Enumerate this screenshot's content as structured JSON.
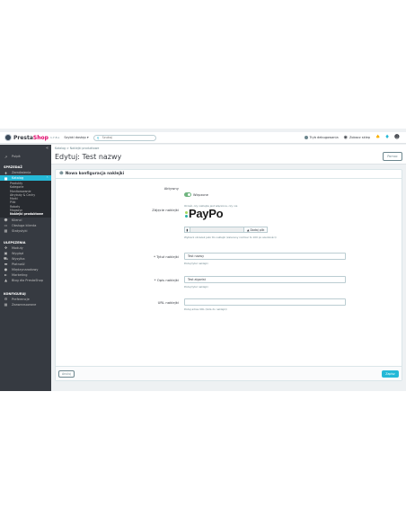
{
  "topbar": {
    "logo_prefix": "Presta",
    "logo_suffix": "Shop",
    "version": "1.7.8.x",
    "quick_access": "Szybki dostęp ▾",
    "search_placeholder": "Szukaj",
    "debug_label": "Tryb debugowania",
    "view_shop": "Zobacz sklep",
    "icons": [
      "bell-icon",
      "cart-icon",
      "user-icon"
    ]
  },
  "sidebar": {
    "top_item": "Pulpit",
    "sections": [
      {
        "title": "SPRZEDAŻ",
        "items": [
          {
            "label": "Zamówienia",
            "icon": "cart-icon"
          },
          {
            "label": "Katalog",
            "icon": "catalog-icon",
            "active": true,
            "subitems": [
              "Produkty",
              "Kategorie",
              "Monitorowanie",
              "Atrybuty & Cechy",
              "Marki",
              "Pliki",
              "Rabaty",
              "Magazyn",
              "Naklejki produktowe"
            ],
            "current": "Naklejki produktowe"
          },
          {
            "label": "Klienci",
            "icon": "user-icon"
          },
          {
            "label": "Obsługa klienta",
            "icon": "chat-icon"
          },
          {
            "label": "Statystyki",
            "icon": "stats-icon"
          }
        ]
      },
      {
        "title": "ULEPSZENIA",
        "items": [
          {
            "label": "Moduły",
            "icon": "puzzle-icon"
          },
          {
            "label": "Wygląd",
            "icon": "monitor-icon"
          },
          {
            "label": "Wysyłka",
            "icon": "truck-icon"
          },
          {
            "label": "Płatność",
            "icon": "card-icon"
          },
          {
            "label": "Międzynarodowy",
            "icon": "globe-icon"
          },
          {
            "label": "Marketing",
            "icon": "megaphone-icon"
          },
          {
            "label": "Blog dla PrestaShop",
            "icon": "folder-icon"
          }
        ]
      },
      {
        "title": "KONFIGURUJ",
        "items": [
          {
            "label": "Preferencje",
            "icon": "gear-icon"
          },
          {
            "label": "Zaawansowane",
            "icon": "advanced-icon"
          }
        ]
      }
    ]
  },
  "header": {
    "breadcrumb": "Katalog  >  Naklejki produktowe",
    "title": "Edytuj: Test nazwy",
    "help_button": "Pomoc"
  },
  "form": {
    "card_title": "Nowa konfiguracja naklejki",
    "active_label": "Aktywny",
    "active_value": "Włączone",
    "active_help": "Określ, czy naklejka jest włączona, czy nie",
    "image_label": "Zdjęcie naklejki",
    "image_brand": "PayPo",
    "file_button": "Dodaj plik",
    "image_help": "Wybierz obrazek jako tło naklejki (zalecany rozmiar to 100 px szerokości)",
    "name_label": "* Tytuł naklejki",
    "name_value": "Test nazwy",
    "name_help": "Podaj tytuł naklejki",
    "desc_label": "* Opis naklejki",
    "desc_value": "Test algorist",
    "desc_help": "Podaj tytuł naklejki",
    "url_label": "URL naklejki",
    "url_value": "",
    "url_help": "Podaj adres URL (lista do naklejki)",
    "cancel_button": "Anuluj",
    "save_button": "Zapisz"
  },
  "colors": {
    "accent": "#25b9d7",
    "sidebar_bg": "#363a41",
    "toggle_on": "#70b580",
    "logo_shop": "#df0067"
  }
}
